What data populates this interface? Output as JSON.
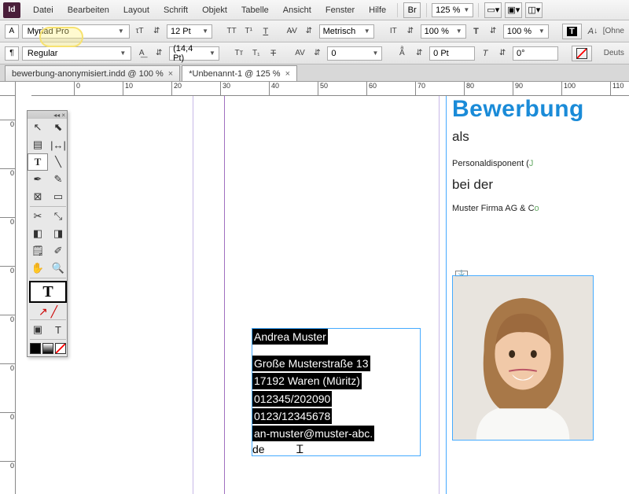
{
  "menubar": {
    "items": [
      "Datei",
      "Bearbeiten",
      "Layout",
      "Schrift",
      "Objekt",
      "Tabelle",
      "Ansicht",
      "Fenster",
      "Hilfe"
    ],
    "br": "Br",
    "zoom": "125 %"
  },
  "ctrl": {
    "font": "Myriad Pro",
    "style": "Regular",
    "size": "12 Pt",
    "leading": "(14,4 Pt)",
    "kerning": "Metrisch",
    "tracking": "0",
    "vscale": "100 %",
    "hscale": "100 %",
    "baseline": "0 Pt",
    "skew": "0°",
    "lang": "Deuts"
  },
  "tabs": [
    {
      "label": "bewerbung-anonymisiert.indd @ 100 %",
      "active": false
    },
    {
      "label": "*Unbenannt-1 @ 125 %",
      "active": true
    }
  ],
  "ruler_h": [
    "0",
    "10",
    "20",
    "30",
    "40",
    "50",
    "60",
    "70",
    "80",
    "90",
    "100",
    "110"
  ],
  "ruler_v": [
    "0",
    "0",
    "0",
    "0",
    "0",
    "0",
    "0",
    "0"
  ],
  "text_block": {
    "name": "Andrea Muster",
    "l1": "Große Musterstraße 13",
    "l2": "17192 Waren (Müritz)",
    "l3": " 012345/202090",
    "l4": "0123/12345678",
    "l5": " an-muster@muster-abc.",
    "l6": "de"
  },
  "right": {
    "title": "Bewerbung",
    "as": "als",
    "role": "Personaldisponent (",
    "at": "bei der",
    "firm": "Muster Firma AG & C"
  },
  "tools": {
    "pairs": [
      [
        "arrow",
        "↖",
        "arrow-white",
        "⬉"
      ],
      [
        "page",
        "▤",
        "gap",
        "↔"
      ],
      [
        "pen",
        "✒",
        "type",
        "T"
      ],
      [
        "",
        "╱",
        "pencil",
        "✎"
      ],
      [
        "rect",
        "▭",
        "ellipse",
        "◯"
      ],
      [
        "scissors",
        "✂",
        "transform",
        "�⿻"
      ],
      [
        "grad",
        "◧",
        "swatch",
        "▦"
      ],
      [
        "note",
        "✎",
        "eyedrop",
        "✐"
      ],
      [
        "hand",
        "✋",
        "zoom",
        "🔍"
      ]
    ]
  }
}
